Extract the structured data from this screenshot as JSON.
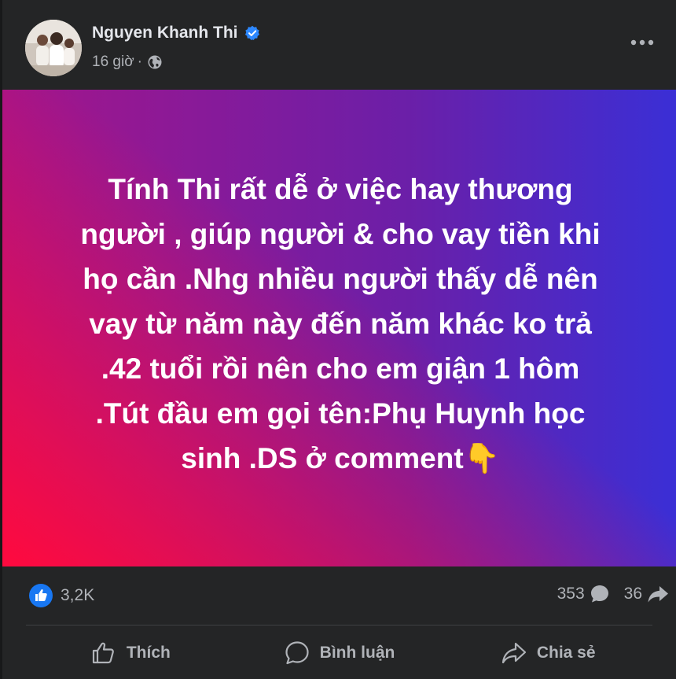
{
  "post": {
    "author": "Nguyen Khanh Thi",
    "time": "16 giờ",
    "separator": "·",
    "text": "Tính Thi rất dễ ở việc hay thương\nngười , giúp người & cho vay tiền khi\nhọ cần .Nhg nhiều người thấy dễ nên\nvay từ năm này đến năm khác ko trả\n.42 tuổi rồi nên cho em giận 1 hôm\n.Tút đầu em gọi tên:Phụ Huynh học\nsinh .DS ở comment👇"
  },
  "stats": {
    "reactions": "3,2K",
    "comments": "353",
    "shares": "36"
  },
  "actions": {
    "like": "Thích",
    "comment": "Bình luận",
    "share": "Chia sẻ"
  },
  "colors": {
    "background": "#242526",
    "verified": "#2d88ff",
    "like_badge": "#1877f2",
    "gradient_start": "#ff0a3e",
    "gradient_end": "#3a2fd6"
  },
  "icons": [
    "verified-badge-icon",
    "globe-icon",
    "more-options-icon",
    "like-reaction-icon",
    "comment-icon",
    "share-icon",
    "thumbs-up-icon"
  ]
}
